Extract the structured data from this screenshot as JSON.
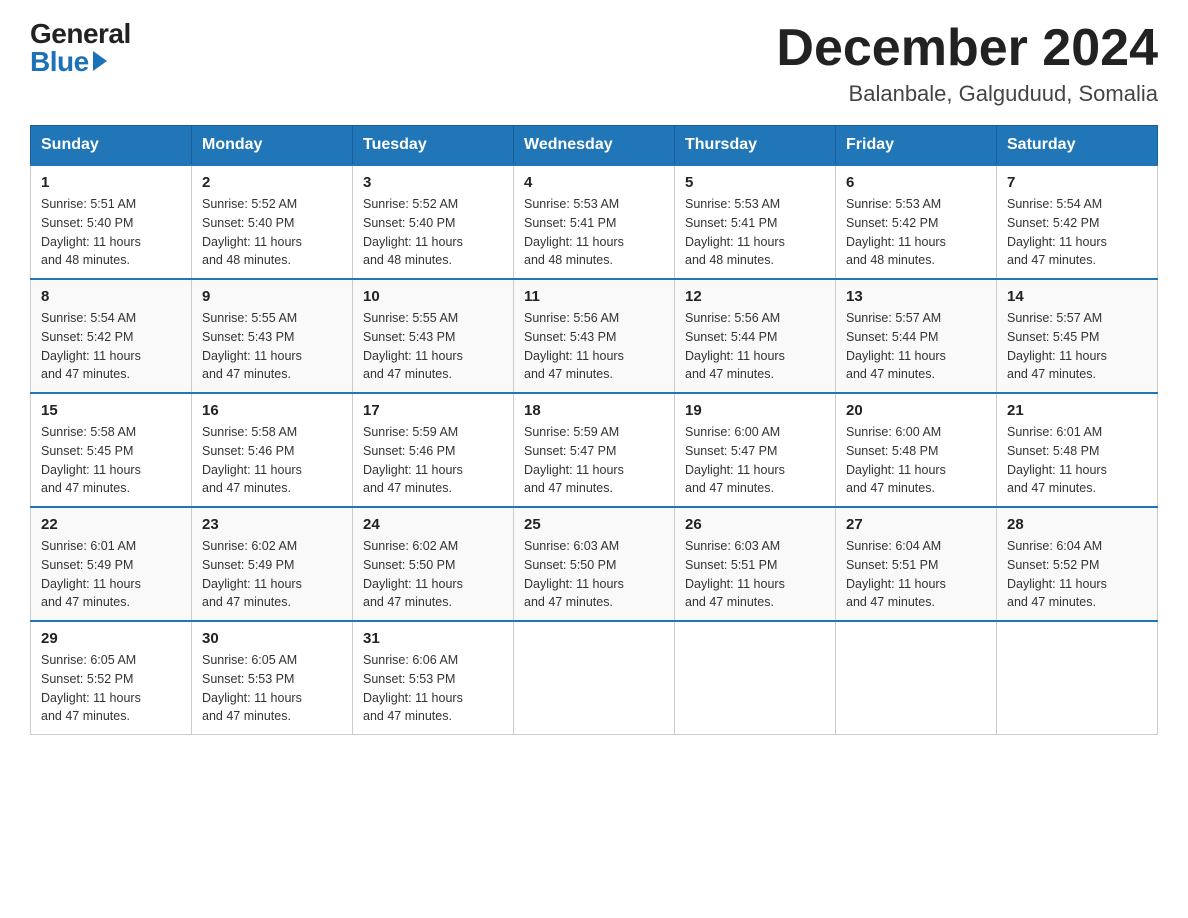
{
  "header": {
    "logo_general": "General",
    "logo_blue": "Blue",
    "month_title": "December 2024",
    "location": "Balanbale, Galguduud, Somalia"
  },
  "days_of_week": [
    "Sunday",
    "Monday",
    "Tuesday",
    "Wednesday",
    "Thursday",
    "Friday",
    "Saturday"
  ],
  "weeks": [
    [
      {
        "day": "1",
        "sunrise": "5:51 AM",
        "sunset": "5:40 PM",
        "daylight": "11 hours and 48 minutes."
      },
      {
        "day": "2",
        "sunrise": "5:52 AM",
        "sunset": "5:40 PM",
        "daylight": "11 hours and 48 minutes."
      },
      {
        "day": "3",
        "sunrise": "5:52 AM",
        "sunset": "5:40 PM",
        "daylight": "11 hours and 48 minutes."
      },
      {
        "day": "4",
        "sunrise": "5:53 AM",
        "sunset": "5:41 PM",
        "daylight": "11 hours and 48 minutes."
      },
      {
        "day": "5",
        "sunrise": "5:53 AM",
        "sunset": "5:41 PM",
        "daylight": "11 hours and 48 minutes."
      },
      {
        "day": "6",
        "sunrise": "5:53 AM",
        "sunset": "5:42 PM",
        "daylight": "11 hours and 48 minutes."
      },
      {
        "day": "7",
        "sunrise": "5:54 AM",
        "sunset": "5:42 PM",
        "daylight": "11 hours and 47 minutes."
      }
    ],
    [
      {
        "day": "8",
        "sunrise": "5:54 AM",
        "sunset": "5:42 PM",
        "daylight": "11 hours and 47 minutes."
      },
      {
        "day": "9",
        "sunrise": "5:55 AM",
        "sunset": "5:43 PM",
        "daylight": "11 hours and 47 minutes."
      },
      {
        "day": "10",
        "sunrise": "5:55 AM",
        "sunset": "5:43 PM",
        "daylight": "11 hours and 47 minutes."
      },
      {
        "day": "11",
        "sunrise": "5:56 AM",
        "sunset": "5:43 PM",
        "daylight": "11 hours and 47 minutes."
      },
      {
        "day": "12",
        "sunrise": "5:56 AM",
        "sunset": "5:44 PM",
        "daylight": "11 hours and 47 minutes."
      },
      {
        "day": "13",
        "sunrise": "5:57 AM",
        "sunset": "5:44 PM",
        "daylight": "11 hours and 47 minutes."
      },
      {
        "day": "14",
        "sunrise": "5:57 AM",
        "sunset": "5:45 PM",
        "daylight": "11 hours and 47 minutes."
      }
    ],
    [
      {
        "day": "15",
        "sunrise": "5:58 AM",
        "sunset": "5:45 PM",
        "daylight": "11 hours and 47 minutes."
      },
      {
        "day": "16",
        "sunrise": "5:58 AM",
        "sunset": "5:46 PM",
        "daylight": "11 hours and 47 minutes."
      },
      {
        "day": "17",
        "sunrise": "5:59 AM",
        "sunset": "5:46 PM",
        "daylight": "11 hours and 47 minutes."
      },
      {
        "day": "18",
        "sunrise": "5:59 AM",
        "sunset": "5:47 PM",
        "daylight": "11 hours and 47 minutes."
      },
      {
        "day": "19",
        "sunrise": "6:00 AM",
        "sunset": "5:47 PM",
        "daylight": "11 hours and 47 minutes."
      },
      {
        "day": "20",
        "sunrise": "6:00 AM",
        "sunset": "5:48 PM",
        "daylight": "11 hours and 47 minutes."
      },
      {
        "day": "21",
        "sunrise": "6:01 AM",
        "sunset": "5:48 PM",
        "daylight": "11 hours and 47 minutes."
      }
    ],
    [
      {
        "day": "22",
        "sunrise": "6:01 AM",
        "sunset": "5:49 PM",
        "daylight": "11 hours and 47 minutes."
      },
      {
        "day": "23",
        "sunrise": "6:02 AM",
        "sunset": "5:49 PM",
        "daylight": "11 hours and 47 minutes."
      },
      {
        "day": "24",
        "sunrise": "6:02 AM",
        "sunset": "5:50 PM",
        "daylight": "11 hours and 47 minutes."
      },
      {
        "day": "25",
        "sunrise": "6:03 AM",
        "sunset": "5:50 PM",
        "daylight": "11 hours and 47 minutes."
      },
      {
        "day": "26",
        "sunrise": "6:03 AM",
        "sunset": "5:51 PM",
        "daylight": "11 hours and 47 minutes."
      },
      {
        "day": "27",
        "sunrise": "6:04 AM",
        "sunset": "5:51 PM",
        "daylight": "11 hours and 47 minutes."
      },
      {
        "day": "28",
        "sunrise": "6:04 AM",
        "sunset": "5:52 PM",
        "daylight": "11 hours and 47 minutes."
      }
    ],
    [
      {
        "day": "29",
        "sunrise": "6:05 AM",
        "sunset": "5:52 PM",
        "daylight": "11 hours and 47 minutes."
      },
      {
        "day": "30",
        "sunrise": "6:05 AM",
        "sunset": "5:53 PM",
        "daylight": "11 hours and 47 minutes."
      },
      {
        "day": "31",
        "sunrise": "6:06 AM",
        "sunset": "5:53 PM",
        "daylight": "11 hours and 47 minutes."
      },
      null,
      null,
      null,
      null
    ]
  ],
  "labels": {
    "sunrise": "Sunrise:",
    "sunset": "Sunset:",
    "daylight": "Daylight:"
  }
}
